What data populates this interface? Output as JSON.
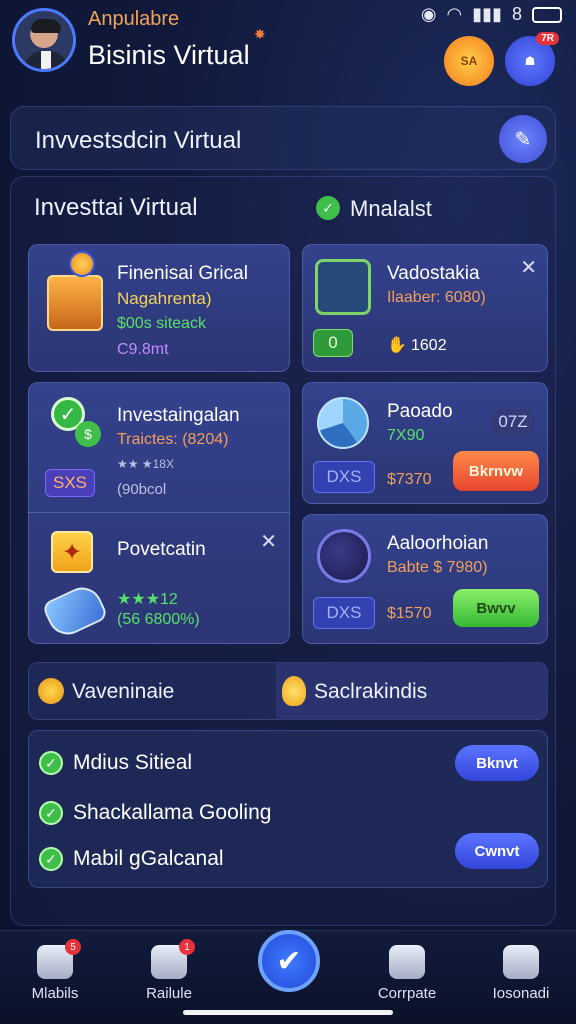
{
  "header": {
    "brand": "Anpulabre",
    "title": "Bisinis Virtual",
    "status_icons": [
      "camera-icon",
      "wifi-icon",
      "signal-icon"
    ],
    "status_text": "8",
    "coin_button_label": "SA",
    "notif_badge": "7R"
  },
  "search": {
    "text": "Invvestsdcin Virtual"
  },
  "sections": {
    "left_title": "Investtai Virtual",
    "right_title": "Mnalalst"
  },
  "cards": {
    "finance": {
      "title": "Finenisai Grical",
      "subtitle": "Nagahrenta)",
      "line3": "$00s siteack",
      "line4": "C9.8mt"
    },
    "safe": {
      "title": "Vadostakia",
      "subtitle": "Ilaaber: 6080)",
      "tag": "0",
      "value": "1602"
    },
    "invest": {
      "title": "Investaingalan",
      "subtitle": "Traictes: (8204)",
      "stars": "★★ ★18X",
      "tag": "SXS",
      "value": "(90bcol"
    },
    "pie": {
      "title": "Paoado",
      "subtitle": "7X90",
      "chip": "07Z",
      "tag": "DXS",
      "price": "$7370",
      "button": "Bkrnvw"
    },
    "poverty": {
      "title": "Povetcatin",
      "stars": "★★★12",
      "value": "(56 6800%)"
    },
    "planet": {
      "title": "Aaloorhoian",
      "subtitle": "Babte $ 7980)",
      "tag": "DXS",
      "price": "$1570",
      "button": "Bwvv"
    }
  },
  "categories": {
    "left": "Vaveninaie",
    "right": "Saclrakindis"
  },
  "tasks": [
    {
      "label": "Mdius Sitieal",
      "button": "Bknvt"
    },
    {
      "label": "Shackallama Gooling",
      "button": ""
    },
    {
      "label": "Mabil gGalcanal",
      "button": "Cwnvt"
    }
  ],
  "nav": [
    {
      "label": "Mlabils",
      "icon": "home-icon",
      "badge": "5"
    },
    {
      "label": "Railule",
      "icon": "house-chart-icon",
      "badge": "1"
    },
    {
      "label": "Corrpate",
      "icon": "checklist-icon",
      "badge": ""
    },
    {
      "label": "Iosonadi",
      "icon": "profile-card-icon",
      "badge": ""
    }
  ]
}
